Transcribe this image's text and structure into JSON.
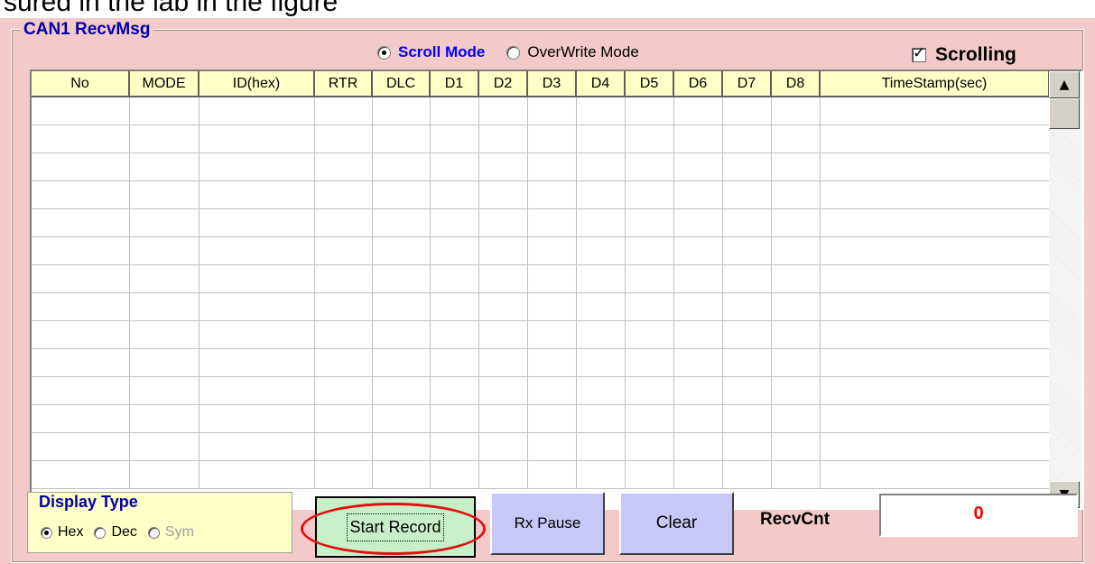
{
  "caption_fragment": "sured in the lab in the figure",
  "group": {
    "title": "CAN1 RecvMsg"
  },
  "modes": {
    "scroll_label": "Scroll Mode",
    "overwrite_label": "OverWrite Mode",
    "selected": "Scroll Mode"
  },
  "scrolling": {
    "label": "Scrolling",
    "checked": true
  },
  "grid": {
    "columns": [
      "No",
      "MODE",
      "ID(hex)",
      "RTR",
      "DLC",
      "D1",
      "D2",
      "D3",
      "D4",
      "D5",
      "D6",
      "D7",
      "D8",
      "TimeStamp(sec)"
    ],
    "rows": []
  },
  "display_type": {
    "legend": "Display Type",
    "options": [
      "Hex",
      "Dec",
      "Sym"
    ],
    "selected": "Hex"
  },
  "buttons": {
    "start_record": "Start Record",
    "rx_pause": "Rx Pause",
    "clear": "Clear"
  },
  "recv": {
    "label": "RecvCnt",
    "count": "0"
  },
  "colors": {
    "panel": "#f4c9c9",
    "title_blue": "#0000a8",
    "header_yellow": "#ffffc8",
    "record_green": "#c8f0c8",
    "button_lavender": "#c8c8f8",
    "count_red": "#ff0000",
    "highlight_red": "#e01010"
  }
}
